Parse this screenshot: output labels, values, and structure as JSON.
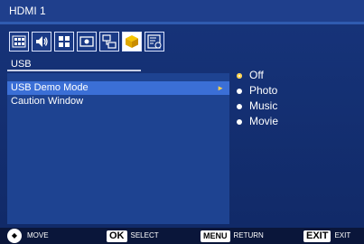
{
  "window": {
    "title": "HDMI 1"
  },
  "tabs": [
    {
      "name": "picture-icon"
    },
    {
      "name": "audio-icon"
    },
    {
      "name": "grid-icon"
    },
    {
      "name": "display-icon"
    },
    {
      "name": "network-icon"
    },
    {
      "name": "usb-box-icon"
    },
    {
      "name": "schedule-icon"
    }
  ],
  "section": {
    "title": "USB"
  },
  "menu": {
    "items": [
      {
        "label": "USB Demo Mode"
      },
      {
        "label": "Caution Window"
      }
    ]
  },
  "options": {
    "items": [
      {
        "label": "Off"
      },
      {
        "label": "Photo"
      },
      {
        "label": "Music"
      },
      {
        "label": "Movie"
      }
    ]
  },
  "footer": {
    "move": "MOVE",
    "ok_key": "OK",
    "select": "SELECT",
    "menu_key": "MENU",
    "return": "RETURN",
    "exit_key": "EXIT",
    "exit": "EXIT"
  },
  "colors": {
    "accent": "#3b6fd6",
    "highlight": "#ffd24a"
  }
}
